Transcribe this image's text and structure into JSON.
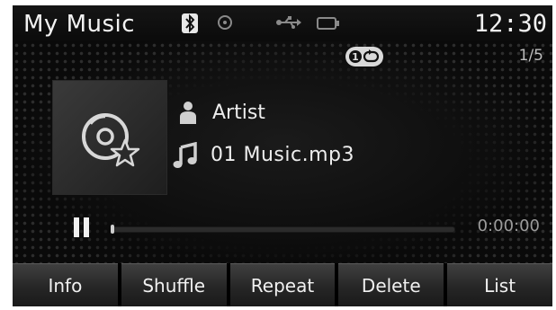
{
  "status_bar": {
    "title": "My Music",
    "time": "12:30",
    "icons": [
      "bluetooth-icon",
      "disc-icon",
      "usb-icon",
      "battery-icon"
    ]
  },
  "playback": {
    "repeat_mode_icon": "repeat-one-icon",
    "track_index": "1/5",
    "artist": "Artist",
    "song": "01 Music.mp3",
    "elapsed": "0:00:00",
    "progress": 0,
    "state_icon": "pause-icon"
  },
  "album_art_icon": "disc-favorite-icon",
  "softkeys": [
    {
      "label": "Info"
    },
    {
      "label": "Shuffle"
    },
    {
      "label": "Repeat"
    },
    {
      "label": "Delete"
    },
    {
      "label": "List"
    }
  ],
  "colors": {
    "background": "#0a0a0a",
    "text": "#e6e6e6",
    "softkey": "#2e2e2e"
  }
}
